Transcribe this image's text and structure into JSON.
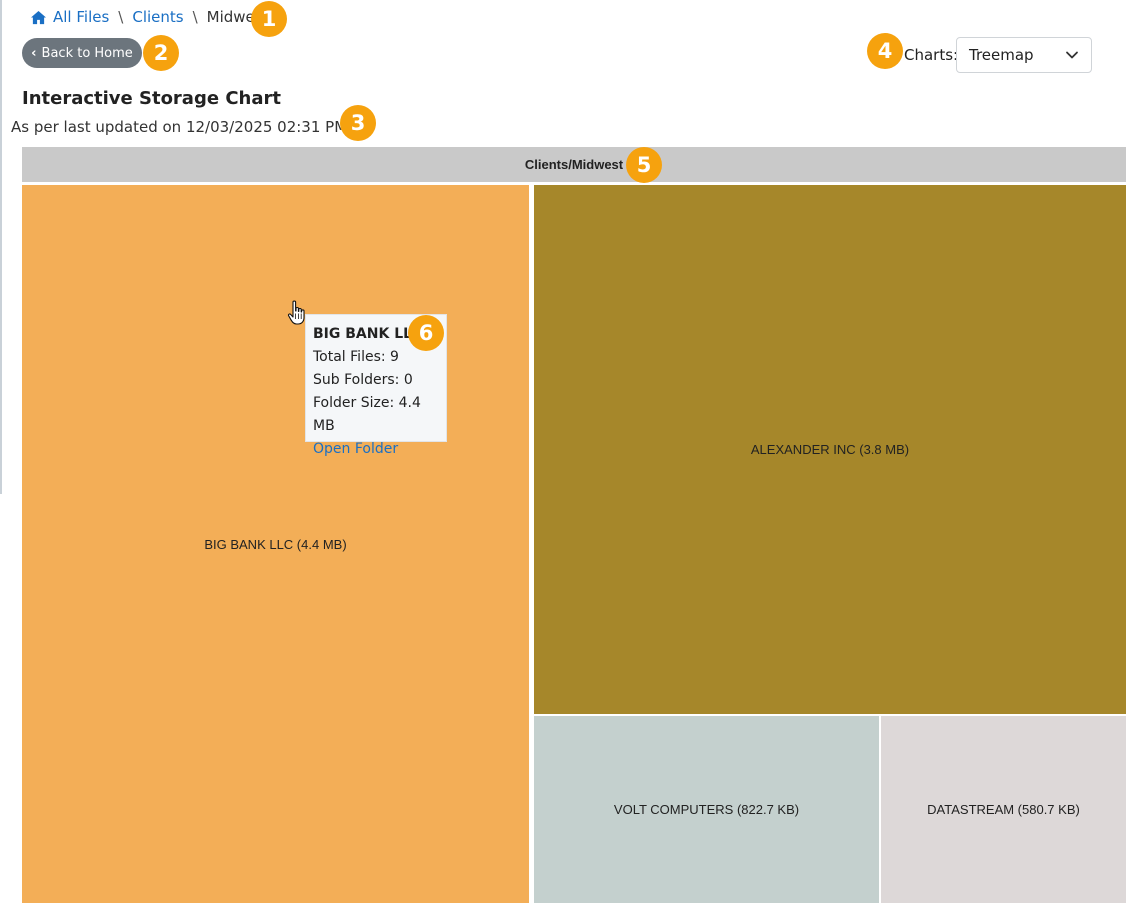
{
  "breadcrumb": {
    "home_icon": "home-icon",
    "items": [
      {
        "label": "All Files"
      },
      {
        "label": "Clients"
      }
    ],
    "current": "Midwest",
    "separator": "\\"
  },
  "back_button": {
    "label": "Back to Home",
    "icon": "chevron-left-icon"
  },
  "charts": {
    "label": "Charts:",
    "selected": "Treemap"
  },
  "title": "Interactive Storage Chart",
  "updated": {
    "text": "As per last updated on 12/03/2025 02:31 PM",
    "icon": "refresh-icon"
  },
  "colors": {
    "breadcrumb_link": "#1a6fc4",
    "back_button": "#6c757d",
    "marker": "#f6a20e",
    "treemap_header": "#c9c9c9",
    "big_bank": "#f3ae57",
    "alexander": "#a6872a",
    "volt": "#c4d0ce",
    "datastream": "#ddd8d8"
  },
  "treemap": {
    "header": "Clients/Midwest",
    "tiles": [
      {
        "label": "BIG BANK LLC (4.4 MB)"
      },
      {
        "label": "ALEXANDER INC (3.8 MB)"
      },
      {
        "label": "VOLT COMPUTERS (822.7 KB)"
      },
      {
        "label": "DATASTREAM (580.7 KB)"
      }
    ]
  },
  "tooltip": {
    "title": "BIG BANK LLC",
    "total_files": "Total Files: 9",
    "sub_folders": "Sub Folders: 0",
    "folder_size": "Folder Size: 4.4 MB",
    "link": "Open Folder"
  },
  "markers": [
    "1",
    "2",
    "3",
    "4",
    "5",
    "6"
  ]
}
